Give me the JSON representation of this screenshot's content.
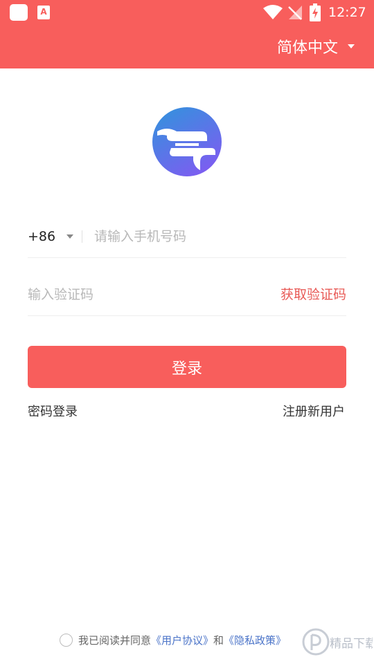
{
  "status_bar": {
    "app_badge": "A",
    "time": "12:27",
    "icons": [
      "notification-square-icon",
      "app-badge-icon",
      "wifi-icon",
      "no-signal-icon",
      "battery-charging-icon"
    ]
  },
  "header": {
    "language": "简体中文",
    "language_caret": "chevron-down-icon"
  },
  "logo": {
    "icon": "app-logo-icon",
    "colors": [
      "#3a8fe0",
      "#7a60ef"
    ]
  },
  "phone": {
    "country_code": "+86",
    "placeholder": "请输入手机号码",
    "value": ""
  },
  "code": {
    "placeholder": "输入验证码",
    "value": "",
    "get_code": "获取验证码"
  },
  "login": {
    "label": "登录"
  },
  "links": {
    "password_login": "密码登录",
    "register": "注册新用户"
  },
  "agreement": {
    "text": "我已阅读并同意",
    "user_agreement": "《用户协议》",
    "and": "和",
    "privacy_policy": "《隐私政策》",
    "checked": false
  },
  "watermark": {
    "text": "精品下载"
  },
  "colors": {
    "brand": "#f85e5c",
    "link": "#e85a56",
    "doc_link": "#4a73c8"
  }
}
